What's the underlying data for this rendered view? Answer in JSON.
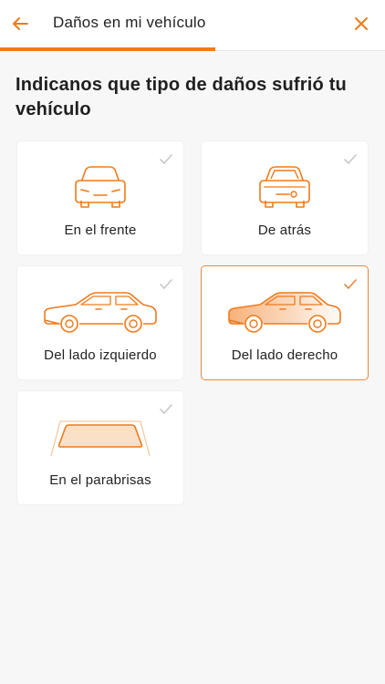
{
  "header": {
    "title": "Daños en mi vehículo",
    "back_icon": "arrow-left-icon",
    "close_icon": "close-icon"
  },
  "progress": {
    "fraction": 0.56
  },
  "colors": {
    "accent": "#ef7a1a",
    "card_selected_border": "#e08a3e",
    "check_inactive": "#c8c8c8"
  },
  "question": "Indicanos que tipo de daños sufrió tu vehículo",
  "options": [
    {
      "label": "En el frente",
      "icon": "car-front-icon",
      "selected": false
    },
    {
      "label": "De atrás",
      "icon": "car-rear-icon",
      "selected": false
    },
    {
      "label": "Del lado izquierdo",
      "icon": "car-left-side-icon",
      "selected": false
    },
    {
      "label": "Del lado derecho",
      "icon": "car-right-side-icon",
      "selected": true
    },
    {
      "label": "En el parabrisas",
      "icon": "windshield-icon",
      "selected": false
    }
  ]
}
